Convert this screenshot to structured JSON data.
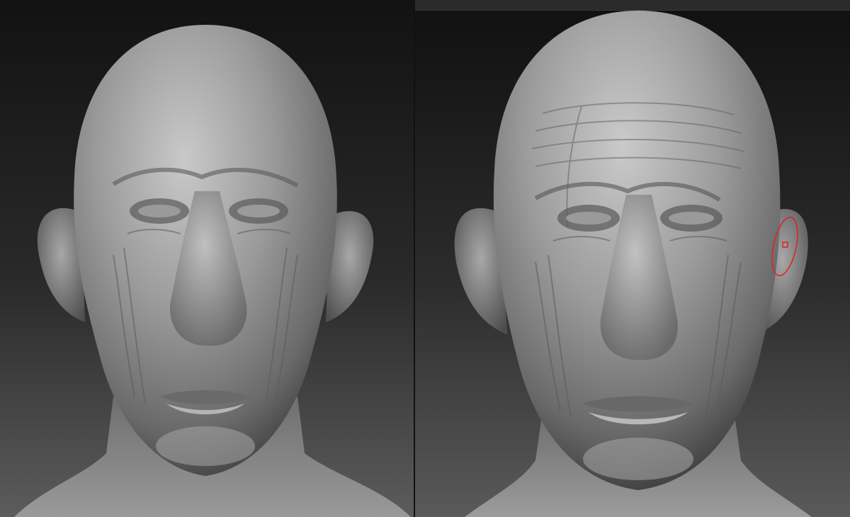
{
  "canvas": {
    "background_top": "#111111",
    "background_bottom": "#5a5a5a",
    "clay_light": "#c8c8c8",
    "clay_mid": "#8c8c8c",
    "clay_dark": "#3f3f3f"
  },
  "brush_cursor": {
    "color": "#e02020"
  }
}
